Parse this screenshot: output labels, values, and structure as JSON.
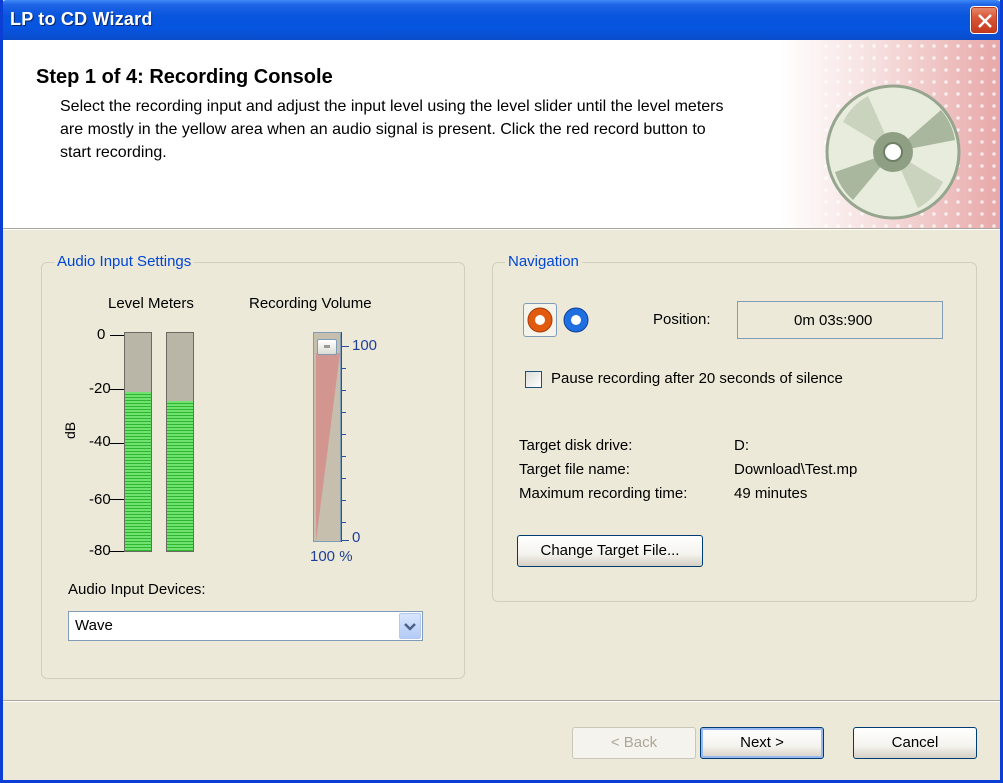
{
  "window": {
    "title": "LP to CD Wizard"
  },
  "header": {
    "step_title": "Step 1 of 4: Recording Console",
    "description": "Select the recording input and adjust the input level using the level slider until the level meters are mostly in the yellow area when an audio signal is present. Click the red record button to start recording."
  },
  "audio_settings": {
    "legend": "Audio Input Settings",
    "level_meters_label": "Level Meters",
    "recording_volume_label": "Recording Volume",
    "db_label": "dB",
    "db_ticks": [
      "0",
      "-20",
      "-40",
      "-60",
      "-80"
    ],
    "meter_left_level": 0.73,
    "meter_right_level": 0.69,
    "volume_max_label": "100",
    "volume_min_label": "0",
    "volume_percent": "100 %",
    "volume_level": 1.0,
    "input_devices_label": "Audio Input Devices:",
    "input_device_value": "Wave"
  },
  "navigation": {
    "legend": "Navigation",
    "position_label": "Position:",
    "position_value": "0m 03s:900",
    "pause_checkbox_label": "Pause recording after 20 seconds of silence",
    "pause_checked": false,
    "target_disk_label": "Target disk drive:",
    "target_disk_value": "D:",
    "target_file_label": "Target file name:",
    "target_file_value": "Download\\Test.mp",
    "max_time_label": "Maximum recording time:",
    "max_time_value": "49 minutes",
    "change_target_button": "Change Target File..."
  },
  "footer": {
    "back_button": "< Back",
    "next_button": "Next >",
    "cancel_button": "Cancel"
  },
  "colors": {
    "title_bar": "#0855dd",
    "legend_text": "#0046d5",
    "meter_green": "#2fb52f",
    "record_button": "#e05a10",
    "play_button": "#1f6fe0"
  }
}
